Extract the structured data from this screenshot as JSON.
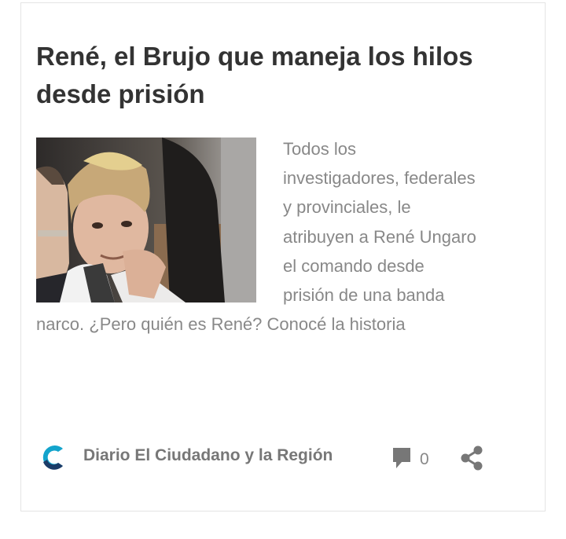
{
  "article": {
    "title": "René, el Brujo que maneja los hilos desde prisión",
    "excerpt": "Todos los investigadores, federales y provinciales, le atribuyen a René Ungaro el comando desde prisión de una banda narco. ¿Pero quién es René? Conocé la historia",
    "source": "Diario El Ciudadano y la Región",
    "comment_count": "0",
    "thumbnail_icon": "photo-icon",
    "comment_icon": "comment-icon",
    "share_icon": "share-icon",
    "logo_icon": "source-logo-icon"
  },
  "colors": {
    "title": "#333333",
    "text": "#888888",
    "logo_primary": "#13a4cc",
    "logo_secondary": "#1b3c68",
    "icon": "#777777",
    "border": "#e4e4e4"
  }
}
